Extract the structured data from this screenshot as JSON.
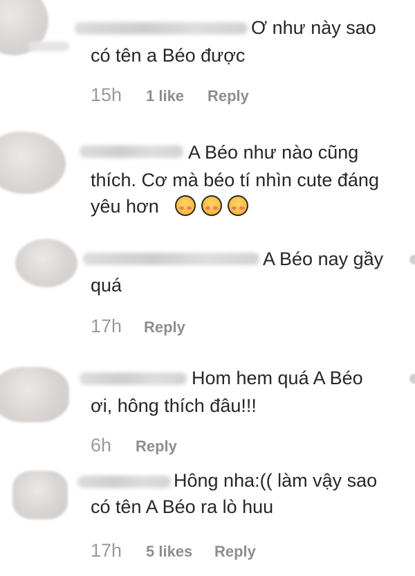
{
  "comments": [
    {
      "text_lines": [
        "Ơ như này sao",
        "có tên a Béo được"
      ],
      "time": "15h",
      "likes": "1 like",
      "reply": "Reply"
    },
    {
      "text_lines": [
        "A Béo như nào cũng",
        "thích. Cơ mà béo tí nhìn cute đáng",
        "yêu hơn"
      ],
      "emojis": [
        "kissing-face-blushing-icon",
        "kissing-face-blushing-icon",
        "kissing-face-blushing-icon"
      ]
    },
    {
      "text_lines": [
        "A Béo nay gầy",
        "quá"
      ],
      "time": "17h",
      "reply": "Reply"
    },
    {
      "text_lines": [
        "Hom hem quá A Béo",
        "ơi, hông thích đâu!!!"
      ],
      "time": "6h",
      "reply": "Reply"
    },
    {
      "text_lines": [
        "Hông nha:(( làm vậy sao",
        "có tên A Béo ra lò huu"
      ],
      "time": "17h",
      "likes": "5 likes",
      "reply": "Reply"
    }
  ]
}
